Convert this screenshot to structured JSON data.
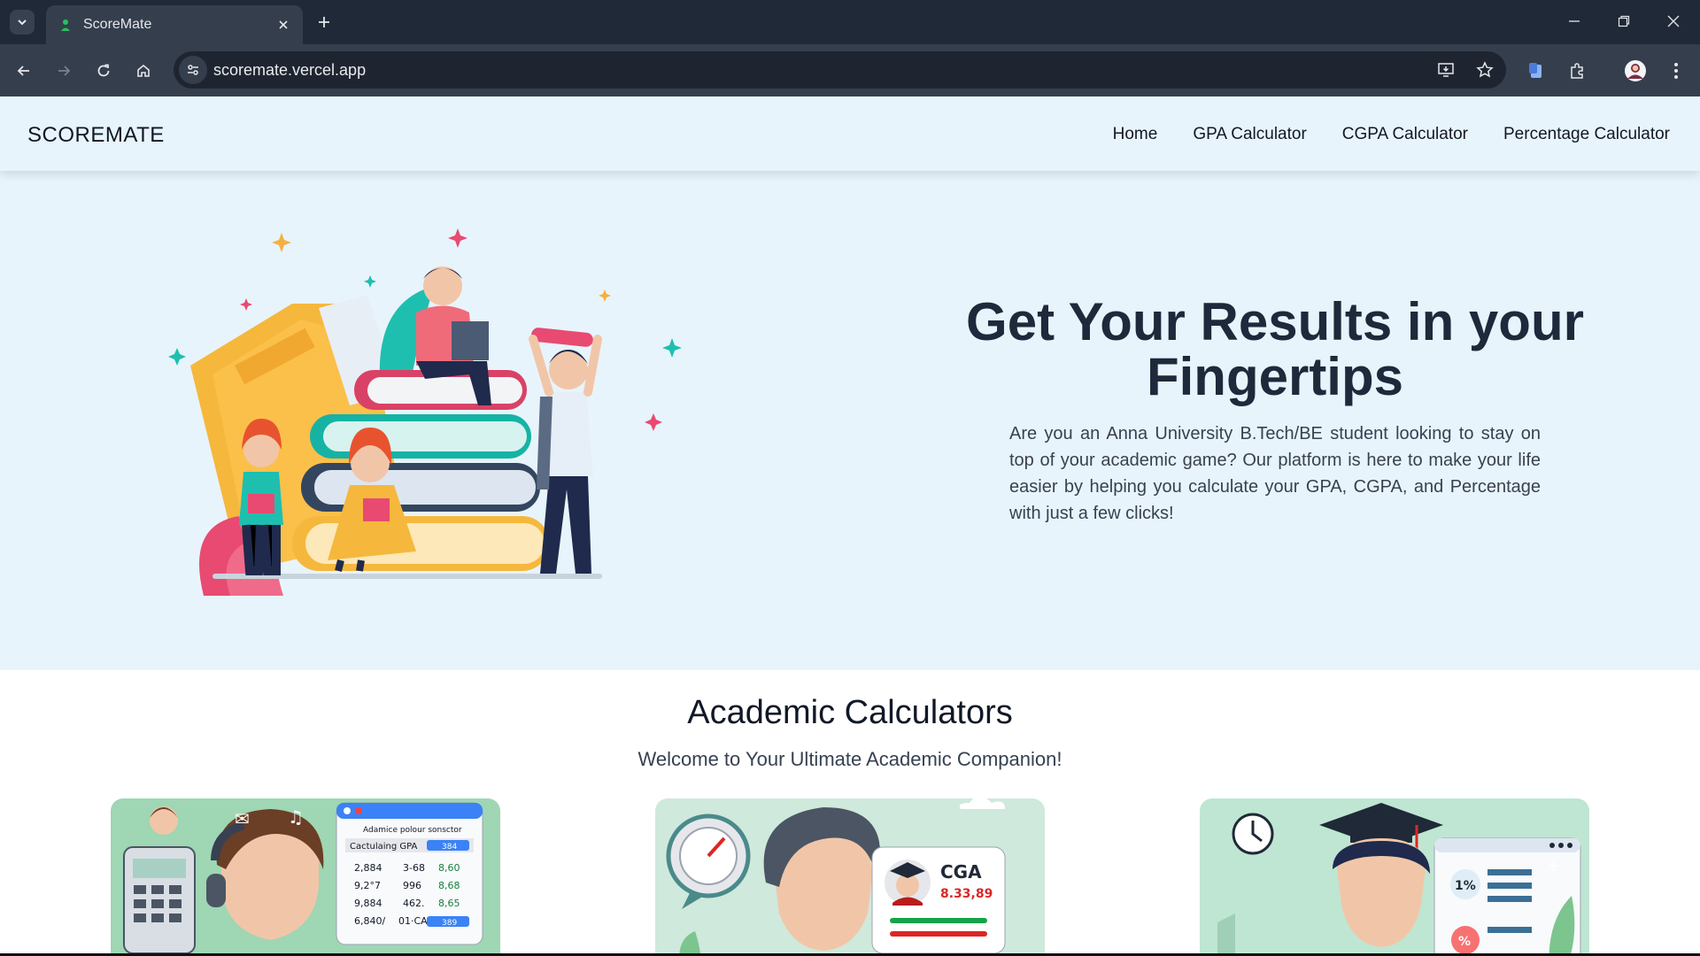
{
  "browser": {
    "tab_title": "ScoreMate",
    "url": "scoremate.vercel.app"
  },
  "nav": {
    "brand": "SCOREMATE",
    "links": [
      "Home",
      "GPA Calculator",
      "CGPA Calculator",
      "Percentage Calculator"
    ]
  },
  "hero": {
    "title": "Get Your Results in your Fingertips",
    "description": "Are you an Anna University B.Tech/BE student looking to stay on top of your academic game? Our platform is here to make your life easier by helping you calculate your GPA, CGPA, and Percentage with just a few clicks!"
  },
  "calculators": {
    "title": "Academic Calculators",
    "subtitle": "Welcome to Your Ultimate Academic Companion!",
    "cards": [
      {
        "heading": "Adamice polour sonsctor",
        "label": "Cactulaing GPA",
        "badge": "384",
        "rows": [
          [
            "2,884",
            "3-68",
            "8,60"
          ],
          [
            "9,2°7",
            "996",
            "8,68"
          ],
          [
            "9,884",
            "462.",
            "8,65"
          ],
          [
            "6,840/",
            "01·CA",
            "389"
          ]
        ]
      },
      {
        "label": "CGA",
        "value": "8.33,89"
      },
      {
        "badge1": "1%",
        "badge2": "%"
      }
    ]
  },
  "colors": {
    "hero_bg": "#e8f4fb",
    "text_dark": "#1e293b",
    "card1_bg": "#9fd6b4",
    "card2_bg": "#cfe9dc",
    "card3_bg": "#bfe6d2"
  }
}
